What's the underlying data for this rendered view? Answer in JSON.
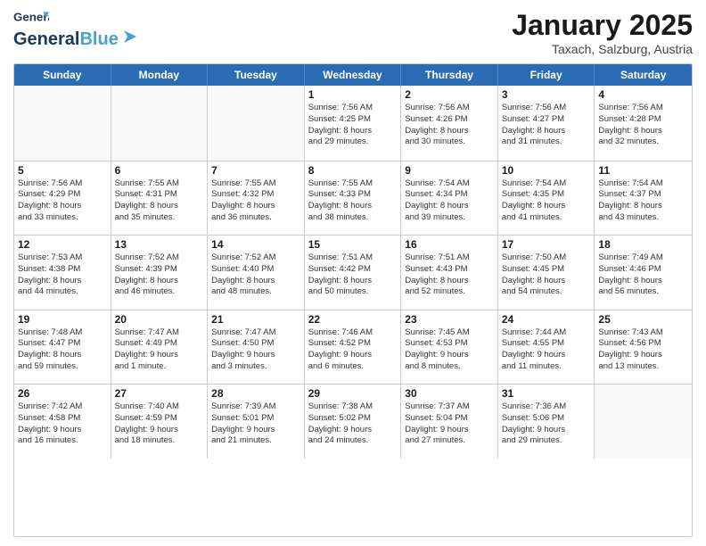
{
  "header": {
    "logo_line1": "General",
    "logo_line2": "Blue",
    "month": "January 2025",
    "location": "Taxach, Salzburg, Austria"
  },
  "weekdays": [
    "Sunday",
    "Monday",
    "Tuesday",
    "Wednesday",
    "Thursday",
    "Friday",
    "Saturday"
  ],
  "weeks": [
    [
      {
        "day": "",
        "info": ""
      },
      {
        "day": "",
        "info": ""
      },
      {
        "day": "",
        "info": ""
      },
      {
        "day": "1",
        "info": "Sunrise: 7:56 AM\nSunset: 4:25 PM\nDaylight: 8 hours\nand 29 minutes."
      },
      {
        "day": "2",
        "info": "Sunrise: 7:56 AM\nSunset: 4:26 PM\nDaylight: 8 hours\nand 30 minutes."
      },
      {
        "day": "3",
        "info": "Sunrise: 7:56 AM\nSunset: 4:27 PM\nDaylight: 8 hours\nand 31 minutes."
      },
      {
        "day": "4",
        "info": "Sunrise: 7:56 AM\nSunset: 4:28 PM\nDaylight: 8 hours\nand 32 minutes."
      }
    ],
    [
      {
        "day": "5",
        "info": "Sunrise: 7:56 AM\nSunset: 4:29 PM\nDaylight: 8 hours\nand 33 minutes."
      },
      {
        "day": "6",
        "info": "Sunrise: 7:55 AM\nSunset: 4:31 PM\nDaylight: 8 hours\nand 35 minutes."
      },
      {
        "day": "7",
        "info": "Sunrise: 7:55 AM\nSunset: 4:32 PM\nDaylight: 8 hours\nand 36 minutes."
      },
      {
        "day": "8",
        "info": "Sunrise: 7:55 AM\nSunset: 4:33 PM\nDaylight: 8 hours\nand 38 minutes."
      },
      {
        "day": "9",
        "info": "Sunrise: 7:54 AM\nSunset: 4:34 PM\nDaylight: 8 hours\nand 39 minutes."
      },
      {
        "day": "10",
        "info": "Sunrise: 7:54 AM\nSunset: 4:35 PM\nDaylight: 8 hours\nand 41 minutes."
      },
      {
        "day": "11",
        "info": "Sunrise: 7:54 AM\nSunset: 4:37 PM\nDaylight: 8 hours\nand 43 minutes."
      }
    ],
    [
      {
        "day": "12",
        "info": "Sunrise: 7:53 AM\nSunset: 4:38 PM\nDaylight: 8 hours\nand 44 minutes."
      },
      {
        "day": "13",
        "info": "Sunrise: 7:52 AM\nSunset: 4:39 PM\nDaylight: 8 hours\nand 46 minutes."
      },
      {
        "day": "14",
        "info": "Sunrise: 7:52 AM\nSunset: 4:40 PM\nDaylight: 8 hours\nand 48 minutes."
      },
      {
        "day": "15",
        "info": "Sunrise: 7:51 AM\nSunset: 4:42 PM\nDaylight: 8 hours\nand 50 minutes."
      },
      {
        "day": "16",
        "info": "Sunrise: 7:51 AM\nSunset: 4:43 PM\nDaylight: 8 hours\nand 52 minutes."
      },
      {
        "day": "17",
        "info": "Sunrise: 7:50 AM\nSunset: 4:45 PM\nDaylight: 8 hours\nand 54 minutes."
      },
      {
        "day": "18",
        "info": "Sunrise: 7:49 AM\nSunset: 4:46 PM\nDaylight: 8 hours\nand 56 minutes."
      }
    ],
    [
      {
        "day": "19",
        "info": "Sunrise: 7:48 AM\nSunset: 4:47 PM\nDaylight: 8 hours\nand 59 minutes."
      },
      {
        "day": "20",
        "info": "Sunrise: 7:47 AM\nSunset: 4:49 PM\nDaylight: 9 hours\nand 1 minute."
      },
      {
        "day": "21",
        "info": "Sunrise: 7:47 AM\nSunset: 4:50 PM\nDaylight: 9 hours\nand 3 minutes."
      },
      {
        "day": "22",
        "info": "Sunrise: 7:46 AM\nSunset: 4:52 PM\nDaylight: 9 hours\nand 6 minutes."
      },
      {
        "day": "23",
        "info": "Sunrise: 7:45 AM\nSunset: 4:53 PM\nDaylight: 9 hours\nand 8 minutes."
      },
      {
        "day": "24",
        "info": "Sunrise: 7:44 AM\nSunset: 4:55 PM\nDaylight: 9 hours\nand 11 minutes."
      },
      {
        "day": "25",
        "info": "Sunrise: 7:43 AM\nSunset: 4:56 PM\nDaylight: 9 hours\nand 13 minutes."
      }
    ],
    [
      {
        "day": "26",
        "info": "Sunrise: 7:42 AM\nSunset: 4:58 PM\nDaylight: 9 hours\nand 16 minutes."
      },
      {
        "day": "27",
        "info": "Sunrise: 7:40 AM\nSunset: 4:59 PM\nDaylight: 9 hours\nand 18 minutes."
      },
      {
        "day": "28",
        "info": "Sunrise: 7:39 AM\nSunset: 5:01 PM\nDaylight: 9 hours\nand 21 minutes."
      },
      {
        "day": "29",
        "info": "Sunrise: 7:38 AM\nSunset: 5:02 PM\nDaylight: 9 hours\nand 24 minutes."
      },
      {
        "day": "30",
        "info": "Sunrise: 7:37 AM\nSunset: 5:04 PM\nDaylight: 9 hours\nand 27 minutes."
      },
      {
        "day": "31",
        "info": "Sunrise: 7:36 AM\nSunset: 5:06 PM\nDaylight: 9 hours\nand 29 minutes."
      },
      {
        "day": "",
        "info": ""
      }
    ]
  ]
}
